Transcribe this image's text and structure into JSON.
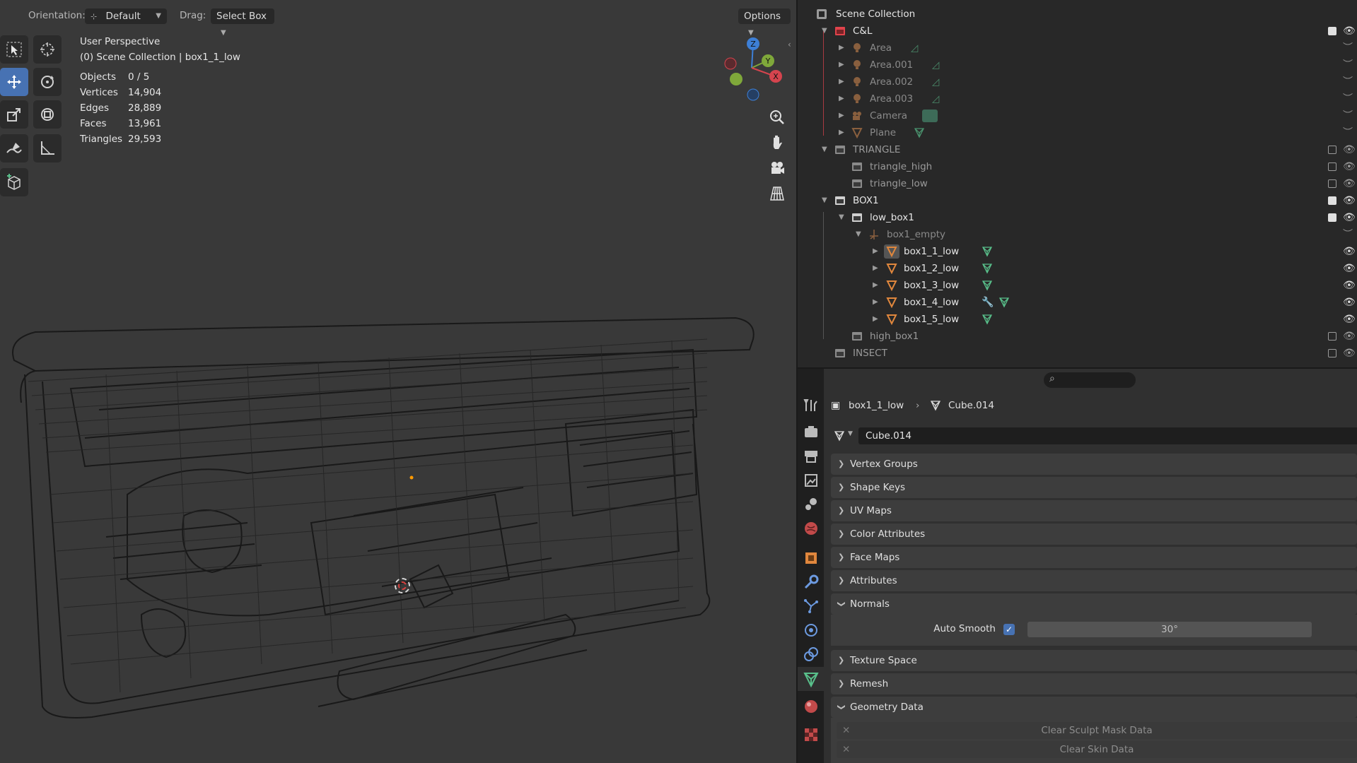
{
  "viewport": {
    "header": {
      "orientation_label": "Orientation:",
      "orientation_value": "Default",
      "drag_label": "Drag:",
      "drag_value": "Select Box",
      "options_label": "Options"
    },
    "overlay": {
      "perspective": "User Perspective",
      "collection_line": "(0) Scene Collection | box1_1_low",
      "stats": [
        {
          "key": "Objects",
          "value": "0 / 5"
        },
        {
          "key": "Vertices",
          "value": "14,904"
        },
        {
          "key": "Edges",
          "value": "28,889"
        },
        {
          "key": "Faces",
          "value": "13,961"
        },
        {
          "key": "Triangles",
          "value": "29,593"
        }
      ]
    },
    "gizmo": {
      "x": "X",
      "y": "Y",
      "z": "Z"
    },
    "tools": [
      "select-box-icon",
      "cursor-icon",
      "move-icon",
      "rotate-icon",
      "scale-icon",
      "transform-icon",
      "annotate-icon",
      "measure-icon",
      "add-cube-icon"
    ],
    "nav_icons": [
      "zoom-icon",
      "pan-hand-icon",
      "camera-view-icon",
      "perspective-grid-icon"
    ]
  },
  "outliner": {
    "root": "Scene Collection",
    "rows": [
      {
        "label": "C&L",
        "type": "collection-red"
      },
      {
        "label": "Area",
        "type": "light"
      },
      {
        "label": "Area.001",
        "type": "light"
      },
      {
        "label": "Area.002",
        "type": "light"
      },
      {
        "label": "Area.003",
        "type": "light"
      },
      {
        "label": "Camera",
        "type": "camera"
      },
      {
        "label": "Plane",
        "type": "mesh"
      },
      {
        "label": "TRIANGLE",
        "type": "collection"
      },
      {
        "label": "triangle_high",
        "type": "collection"
      },
      {
        "label": "triangle_low",
        "type": "collection"
      },
      {
        "label": "BOX1",
        "type": "collection"
      },
      {
        "label": "low_box1",
        "type": "collection"
      },
      {
        "label": "box1_empty",
        "type": "empty"
      },
      {
        "label": "box1_1_low",
        "type": "mesh"
      },
      {
        "label": "box1_2_low",
        "type": "mesh"
      },
      {
        "label": "box1_3_low",
        "type": "mesh"
      },
      {
        "label": "box1_4_low",
        "type": "mesh"
      },
      {
        "label": "box1_5_low",
        "type": "mesh"
      },
      {
        "label": "high_box1",
        "type": "collection"
      },
      {
        "label": "INSECT",
        "type": "collection"
      }
    ]
  },
  "properties": {
    "breadcrumb_object": "box1_1_low",
    "breadcrumb_data": "Cube.014",
    "data_name": "Cube.014",
    "panels": [
      {
        "label": "Vertex Groups",
        "open": false
      },
      {
        "label": "Shape Keys",
        "open": false
      },
      {
        "label": "UV Maps",
        "open": false
      },
      {
        "label": "Color Attributes",
        "open": false
      },
      {
        "label": "Face Maps",
        "open": false
      },
      {
        "label": "Attributes",
        "open": false
      },
      {
        "label": "Normals",
        "open": true
      },
      {
        "label": "Texture Space",
        "open": false
      },
      {
        "label": "Remesh",
        "open": false
      },
      {
        "label": "Geometry Data",
        "open": true
      }
    ],
    "auto_smooth_label": "Auto Smooth",
    "auto_smooth_angle": "30°",
    "clear_sculpt_mask": "Clear Sculpt Mask Data",
    "clear_skin": "Clear Skin Data"
  },
  "colors": {
    "accent": "#4772b3",
    "mesh_orange": "#e0873d",
    "data_green": "#59c08b",
    "collection_red": "#e0434b"
  }
}
